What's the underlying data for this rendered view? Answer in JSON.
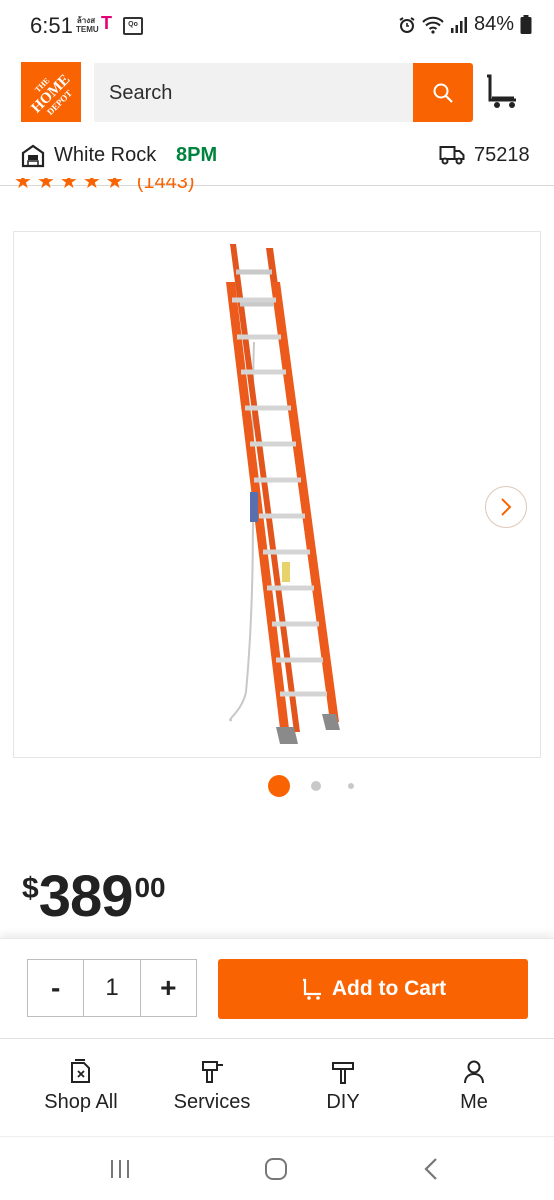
{
  "status_bar": {
    "time": "6:51",
    "temu_line1": "ล้างส",
    "temu_line2": "TEMU",
    "carrier": "T",
    "notif_box": "Qo",
    "battery": "84%"
  },
  "header": {
    "logo": {
      "line1": "THE",
      "line2": "HOME",
      "line3": "DEPOT"
    },
    "search_placeholder": "Search"
  },
  "location": {
    "store_name": "White Rock",
    "store_hours": "8PM",
    "zip": "75218"
  },
  "rating": {
    "stars": 4.5,
    "count_fragment": "(1443)"
  },
  "gallery": {
    "image": "extension-ladder",
    "current_index": 0,
    "dot_count": 3
  },
  "price": {
    "currency": "$",
    "dollars": "389",
    "cents": "00"
  },
  "purchase": {
    "minus_label": "-",
    "quantity": "1",
    "plus_label": "+",
    "add_to_cart_label": "Add to Cart"
  },
  "bottom_nav": {
    "items": [
      {
        "label": "Shop All",
        "icon": "shop-all-icon"
      },
      {
        "label": "Services",
        "icon": "services-drill-icon"
      },
      {
        "label": "DIY",
        "icon": "diy-hammer-icon"
      },
      {
        "label": "Me",
        "icon": "person-icon"
      }
    ]
  },
  "colors": {
    "brand_orange": "#f96302",
    "hours_green": "#00843d"
  }
}
